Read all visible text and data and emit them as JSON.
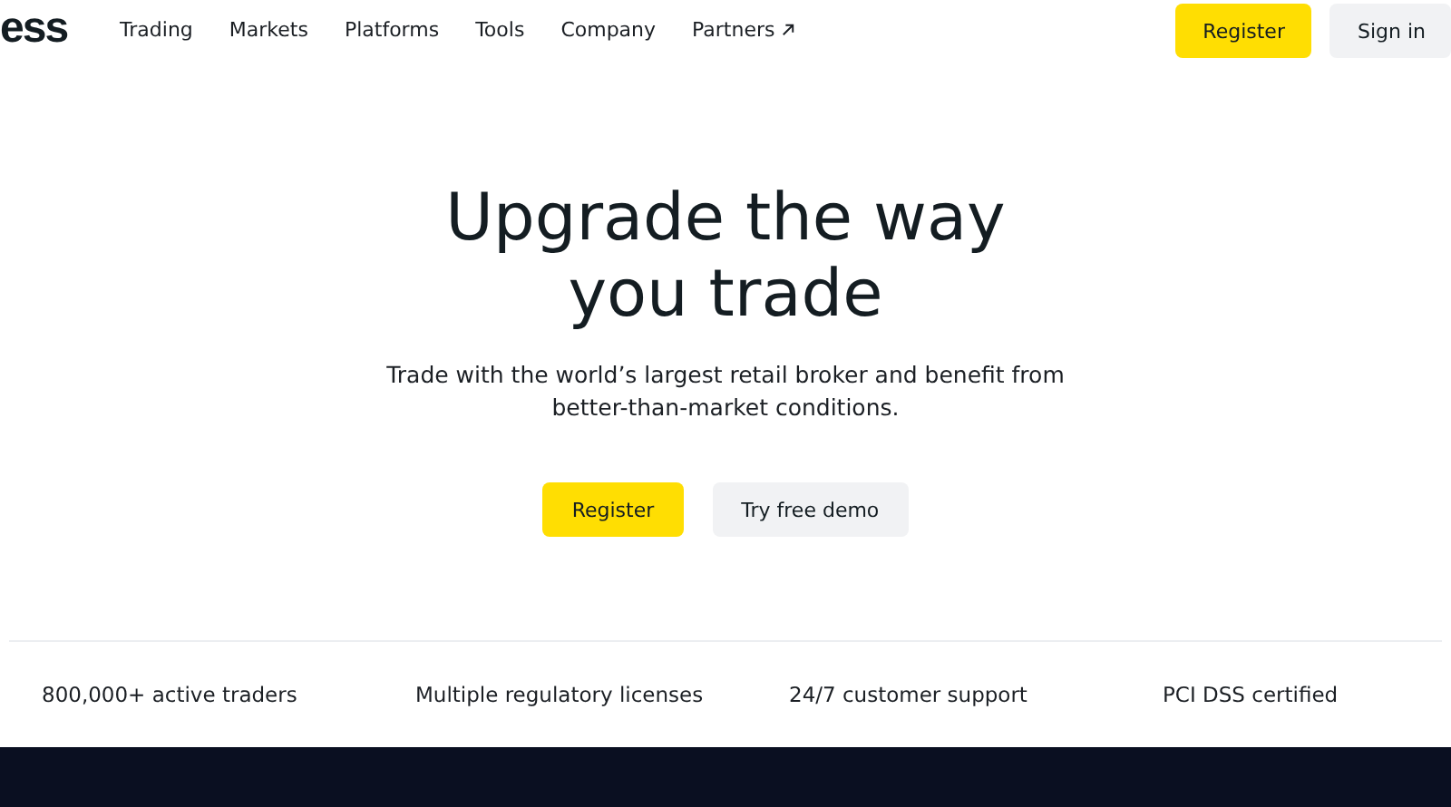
{
  "header": {
    "logo": "ess",
    "nav": [
      {
        "label": "Trading",
        "external": false
      },
      {
        "label": "Markets",
        "external": false
      },
      {
        "label": "Platforms",
        "external": false
      },
      {
        "label": "Tools",
        "external": false
      },
      {
        "label": "Company",
        "external": false
      },
      {
        "label": "Partners",
        "external": true
      }
    ],
    "buttons": [
      {
        "label": "Register",
        "kind": "primary"
      },
      {
        "label": "Sign in",
        "kind": "secondary"
      }
    ]
  },
  "hero": {
    "title_lines": [
      "Upgrade the way",
      "you trade"
    ],
    "subtitle_lines": [
      "Trade with the world’s largest retail broker and benefit from",
      "better-than-market conditions."
    ],
    "buttons": [
      {
        "label": "Register",
        "kind": "primary"
      },
      {
        "label": "Try free demo",
        "kind": "secondary"
      }
    ]
  },
  "features": [
    "800,000+ active traders",
    "Multiple regulatory licenses",
    "24/7 customer support",
    "PCI DSS certified"
  ]
}
